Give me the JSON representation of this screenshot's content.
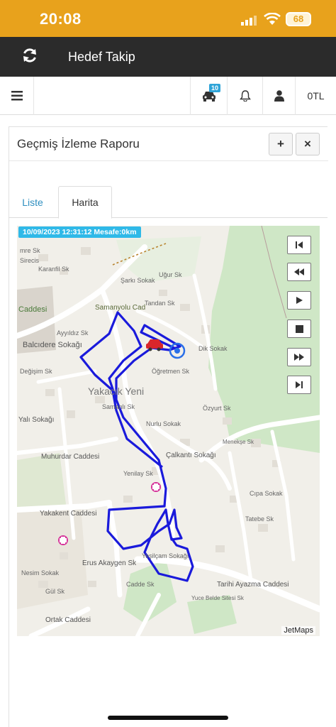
{
  "status": {
    "time": "20:08",
    "battery": "68"
  },
  "appbar": {
    "title": "Hedef Takip"
  },
  "toolbar": {
    "vehicle_badge": "10",
    "balance": "0TL"
  },
  "panel": {
    "title": "Geçmiş İzleme Raporu",
    "add_label": "+",
    "close_label": "×"
  },
  "tabs": [
    {
      "label": "Liste"
    },
    {
      "label": "Harita"
    }
  ],
  "map": {
    "info": "10/09/2023 12:31:12 Mesafe:0km",
    "credit": "JetMaps",
    "labels": [
      "mre Sk",
      "Sirecis",
      "Karanfil Sk",
      "Caddesi",
      "Balcıdere Sokağı",
      "Ayyıldız Sk",
      "Şarkı Sokak",
      "Samanyolu Cad",
      "Tandan Sk",
      "Uğur Sk",
      "Öğretmen Sk",
      "Dik Sokak",
      "Yakacık Yeni",
      "Değişim Sk",
      "Samanlı Sk",
      "Özyurt Sk",
      "Nurlu Sokak",
      "Muhurdar Caddesi",
      "Yalı Sokağı",
      "Çalkantı Sokağı",
      "Yenilay Sk",
      "Yakakent Caddesi",
      "Tarihi Ayazma Caddesi",
      "Erus Akaygen Sk",
      "Yeşilçam Sokağı",
      "Yuce Belde Sitesi Sk",
      "Menekşe Sk",
      "Tatebe Sk",
      "Cıpa Sokak",
      "Nesim Sokak",
      "Gül Sk",
      "Cadde Sk",
      "Ortak Caddesi"
    ]
  },
  "colors": {
    "route": "#1a1adb",
    "accent": "#e8a21c",
    "info": "#2fb9e8",
    "link": "#2f8fc0"
  }
}
